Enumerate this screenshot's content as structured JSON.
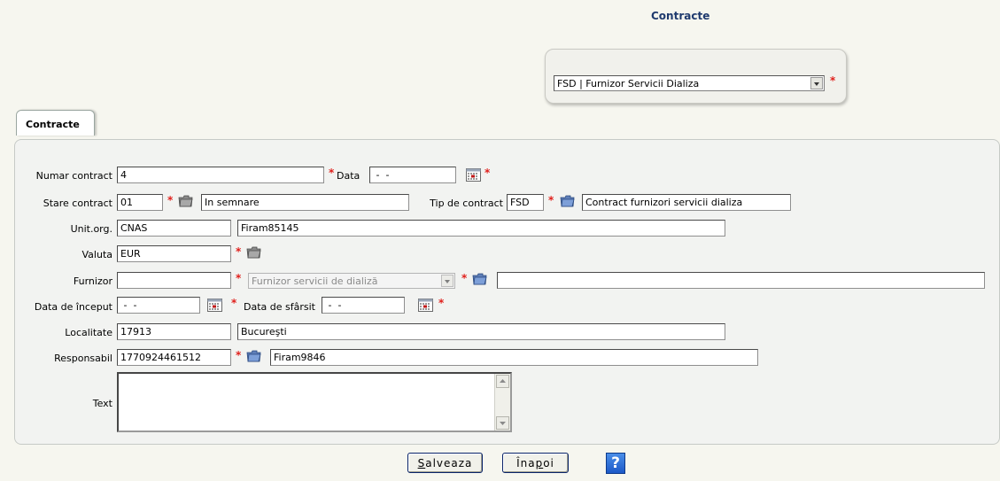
{
  "page": {
    "title": "Contracte"
  },
  "contract_type_select": {
    "value": "FSD | Furnizor Servicii Dializa"
  },
  "tabs": [
    {
      "label": "Contracte"
    }
  ],
  "form": {
    "numar_contract": {
      "label": "Numar contract",
      "value": "4"
    },
    "data": {
      "label": "Data",
      "value": " -  - "
    },
    "stare_contract": {
      "label": "Stare contract",
      "code": "01",
      "description": "In semnare"
    },
    "tip_contract": {
      "label": "Tip de contract",
      "code": "FSD",
      "description": "Contract furnizori servicii dializa"
    },
    "unit_org": {
      "label": "Unit.org.",
      "code": "CNAS",
      "description": "Firam85145"
    },
    "valuta": {
      "label": "Valuta",
      "value": "EUR"
    },
    "furnizor": {
      "label": "Furnizor",
      "code": "",
      "type_value": "Furnizor servicii de dializă",
      "description": ""
    },
    "data_inceput": {
      "label": "Data de început",
      "value": " -  - "
    },
    "data_sfarsit": {
      "label": "Data de sfârsit",
      "value": " -  - "
    },
    "localitate": {
      "label": "Localitate",
      "code": "17913",
      "description": "Bucureşti"
    },
    "responsabil": {
      "label": "Responsabil",
      "code": "1770924461512",
      "description": "Firam9846"
    },
    "text": {
      "label": "Text",
      "value": ""
    }
  },
  "buttons": {
    "save": {
      "underline": "S",
      "rest": "alveaza"
    },
    "back": {
      "pre": "Îna",
      "underline": "p",
      "rest": "oi"
    },
    "help": {
      "label": "?"
    }
  },
  "colors": {
    "required": "#e0201c",
    "title": "#1f3a6e"
  },
  "icons": [
    "folder-icon",
    "calendar-icon",
    "dropdown-arrow-icon",
    "help-icon"
  ]
}
